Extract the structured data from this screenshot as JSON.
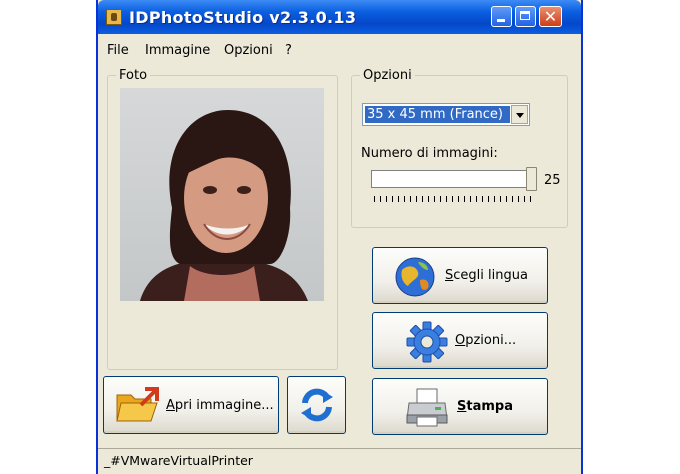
{
  "window": {
    "title": "IDPhotoStudio v2.3.0.13"
  },
  "menu": [
    "File",
    "Immagine",
    "Opzioni",
    "?"
  ],
  "photo_group": {
    "legend": "Foto"
  },
  "options_group": {
    "legend": "Opzioni",
    "format": "35 x 45 mm (France)",
    "count_label": "Numero di immagini:",
    "count_value": "25",
    "count_level": 1.0
  },
  "buttons": {
    "language": {
      "accel": "S",
      "rest": "cegli lingua"
    },
    "options": {
      "accel": "O",
      "rest": "pzioni..."
    },
    "print": {
      "accel": "S",
      "rest": "tampa"
    },
    "open": {
      "accel": "A",
      "rest": "pri immagine..."
    }
  },
  "icons": {
    "app": "app-icon",
    "globe": "globe-icon",
    "gear": "gear-icon",
    "printer": "printer-icon",
    "folder": "folder-icon",
    "refresh": "refresh-icon"
  },
  "status": {
    "printer": "_#VMwareVirtualPrinter"
  },
  "colors": {
    "titlebar": "#0a5fe0",
    "selection": "#316ac5",
    "dialog": "#ece9d8"
  }
}
